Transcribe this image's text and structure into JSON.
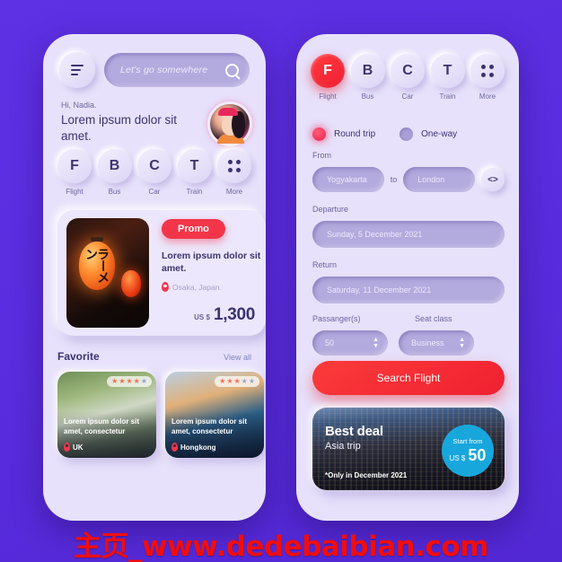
{
  "watermark": "主页_www.dedebaibian.com",
  "colors": {
    "background": "#5b2ee0",
    "phone_bg": "#e7e1fb",
    "accent_red": "#f02030",
    "accent_pink": "#f0234d",
    "text_dark": "#3b3470",
    "text_muted": "#6d659c",
    "pill_fill": "#b3aade",
    "deal_circle": "#18a7dc"
  },
  "home_screen": {
    "menu_icon": "hamburger-icon",
    "search": {
      "placeholder": "Let's go somewhere",
      "icon": "search-icon"
    },
    "greeting": {
      "hi": "Hi, Nadia.",
      "title": "Lorem ipsum dolor sit amet."
    },
    "avatar_alt": "user-avatar",
    "nav": [
      {
        "letter": "F",
        "label": "Flight"
      },
      {
        "letter": "B",
        "label": "Bus"
      },
      {
        "letter": "C",
        "label": "Car"
      },
      {
        "letter": "T",
        "label": "Train"
      },
      {
        "letter": "",
        "label": "More",
        "icon": "grid-dots-icon"
      }
    ],
    "promo": {
      "badge": "Promo",
      "title": "Lorem ipsum dolor sit amet.",
      "location": "Osaka, Japan.",
      "currency": "US $",
      "price": "1,300",
      "lantern_text": "ラーメン"
    },
    "favorite": {
      "heading": "Favorite",
      "view_all": "View all",
      "cards": [
        {
          "rating": 4,
          "max_rating": 5,
          "title": "Lorem ipsum dolor sit amet, consectetur",
          "location": "UK"
        },
        {
          "rating": 3,
          "max_rating": 5,
          "title": "Lorem ipsum dolor sit amet, consectetur",
          "location": "Hongkong"
        }
      ]
    }
  },
  "search_screen": {
    "nav": [
      {
        "letter": "F",
        "label": "Flight",
        "active": true
      },
      {
        "letter": "B",
        "label": "Bus",
        "active": false
      },
      {
        "letter": "C",
        "label": "Car",
        "active": false
      },
      {
        "letter": "T",
        "label": "Train",
        "active": false
      },
      {
        "letter": "",
        "label": "More",
        "active": false,
        "icon": "grid-dots-icon"
      }
    ],
    "trip_type": {
      "round_trip": "Round trip",
      "one_way": "One-way",
      "selected": "Round trip"
    },
    "from": {
      "label": "From",
      "value": "Yogyakarta",
      "to_label": "to",
      "destination": "London",
      "swap_icon": "swap-arrows-icon"
    },
    "departure": {
      "label": "Departure",
      "value": "Sunday, 5 December 2021"
    },
    "return": {
      "label": "Return",
      "value": "Saturday, 11 December 2021"
    },
    "passengers": {
      "label": "Passanger(s)",
      "value": "50"
    },
    "seat_class": {
      "label": "Seat class",
      "value": "Business"
    },
    "submit": "Search Flight",
    "deal": {
      "title": "Best deal",
      "subtitle": "Asia trip",
      "note": "*Only in December 2021",
      "start_from": "Start from",
      "currency": "US $",
      "price": "50"
    }
  }
}
